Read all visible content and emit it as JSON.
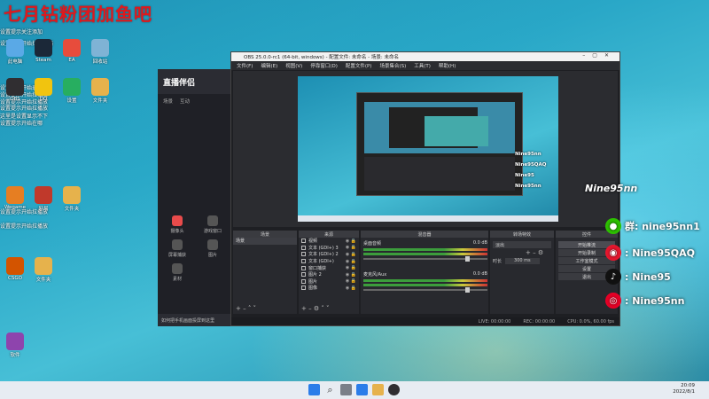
{
  "banner": "七月钻粉团加鱼吧",
  "annotations": [
    "设置提示关注添加",
    "设置提示开始拉播放器",
    "设置提示开始录播放",
    "设置提示开始拉播放",
    "设置提示开始拉播放",
    "设置提示开始拉播放",
    "这里是设置显示不下",
    "设置提示开始在哪",
    "设置提示开始拉播放",
    "设置提示开始拉播放"
  ],
  "desktop_icons": [
    {
      "label": "此电脑",
      "color": "#5aa9e6"
    },
    {
      "label": "Steam",
      "color": "#1b2838"
    },
    {
      "label": "EA",
      "color": "#e74c3c"
    },
    {
      "label": "回收站",
      "color": "#7fb3d5"
    },
    {
      "label": "OBS",
      "color": "#302e31"
    },
    {
      "label": "QQ",
      "color": "#f1c40f"
    },
    {
      "label": "设置",
      "color": "#27ae60"
    },
    {
      "label": "文件夹",
      "color": "#e6b24c"
    },
    {
      "label": "Wegame",
      "color": "#e67e22"
    },
    {
      "label": "网易",
      "color": "#c0392b"
    },
    {
      "label": "文件夹",
      "color": "#e6b24c"
    },
    {
      "label": "CSGO",
      "color": "#d35400"
    },
    {
      "label": "文件夹",
      "color": "#e6b24c"
    },
    {
      "label": "软件",
      "color": "#8e44ad"
    }
  ],
  "companion": {
    "logo": "直播伴侣",
    "tabs": [
      "场景",
      "互动"
    ],
    "menu": [
      "摄像头",
      "游戏窗口",
      "屏幕捕获",
      "图片",
      "素材"
    ],
    "footer": "如何把手机画面投屏到这里"
  },
  "obs": {
    "title": "OBS 25.0.0-rc1 (64-bit, windows) - 配置文件: 未命名 - 场景: 未命名",
    "menu": [
      "文件(F)",
      "编辑(E)",
      "视图(V)",
      "停靠窗口(D)",
      "配置文件(P)",
      "场景集合(S)",
      "工具(T)",
      "帮助(H)"
    ],
    "docks": {
      "scenes": "场景",
      "sources": "来源",
      "mixer": "混音器",
      "transitions": "转场特效",
      "controls": "控件"
    },
    "scene_name": "场景",
    "sources": [
      "视频",
      "文本 (GDI+) 3",
      "文本 (GDI+) 2",
      "文本 (GDI+)",
      "窗口捕获",
      "图片 2",
      "图片",
      "图像"
    ],
    "mixer": [
      {
        "name": "桌面音频",
        "db": "0.0 dB"
      },
      {
        "name": "麦克风/Aux",
        "db": "0.0 dB"
      }
    ],
    "transition": {
      "type": "淡出",
      "duration_label": "时长",
      "duration": "300 ms"
    },
    "controls": [
      "开始推流",
      "开始录制",
      "工作室模式",
      "设置",
      "退出"
    ],
    "status": {
      "live": "LIVE: 00:00:00",
      "rec": "REC: 00:00:00",
      "cpu": "CPU: 0.0%, 60.00 fps"
    },
    "inner_social": [
      "Nine95nn",
      "Nine95QAQ",
      "Nine95",
      "Nine95nn"
    ]
  },
  "overlay_title": "Nine95nn",
  "social": [
    {
      "icon": "wechat-icon",
      "text": "群: nine95nn1",
      "color": "#2dc100"
    },
    {
      "icon": "weibo-icon",
      "text": ": Nine95QAQ",
      "color": "#e6162d"
    },
    {
      "icon": "tiktok-icon",
      "text": ": Nine95",
      "color": "#111111"
    },
    {
      "icon": "netease-icon",
      "text": ": Nine95nn",
      "color": "#e60026"
    }
  ],
  "clock": {
    "time": "20:09",
    "date": "2022/8/1"
  }
}
